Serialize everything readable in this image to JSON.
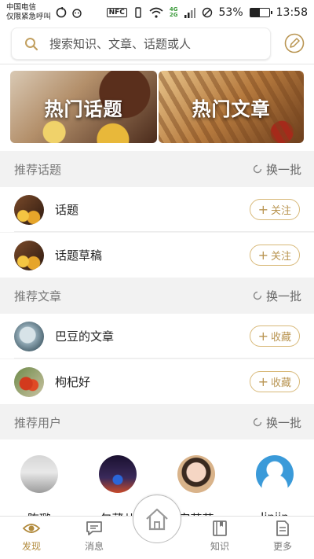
{
  "status_bar": {
    "carrier_line1": "中国电信",
    "carrier_line2": "仅限紧急呼叫",
    "network": "4G",
    "battery": "53%",
    "battery_level": 0.53,
    "time": "13:58"
  },
  "search": {
    "placeholder": "搜索知识、文章、话题或人"
  },
  "banners": [
    {
      "title": "热门话题"
    },
    {
      "title": "热门文章"
    }
  ],
  "sections": {
    "topics": {
      "title": "推荐话题",
      "refresh_label": "换一批",
      "items": [
        {
          "title": "话题",
          "action": "关注"
        },
        {
          "title": "话题草稿",
          "action": "关注"
        }
      ]
    },
    "articles": {
      "title": "推荐文章",
      "refresh_label": "换一批",
      "items": [
        {
          "title": "巴豆的文章",
          "action": "收藏"
        },
        {
          "title": "枸杞好",
          "action": "收藏"
        }
      ]
    },
    "users": {
      "title": "推荐用户",
      "refresh_label": "换一批",
      "items": [
        {
          "name": "陈璐"
        },
        {
          "name": "包葳儿"
        },
        {
          "name": "安芳芳"
        },
        {
          "name": "linjin"
        }
      ]
    }
  },
  "bottom_nav": {
    "items": [
      {
        "label": "发现",
        "icon": "eye-icon",
        "active": true
      },
      {
        "label": "消息",
        "icon": "chat-icon"
      },
      {
        "label": "",
        "icon": "home-icon"
      },
      {
        "label": "知识",
        "icon": "book-icon"
      },
      {
        "label": "更多",
        "icon": "document-icon"
      }
    ]
  },
  "colors": {
    "accent": "#b28b3e",
    "button_border": "#d8b979"
  }
}
